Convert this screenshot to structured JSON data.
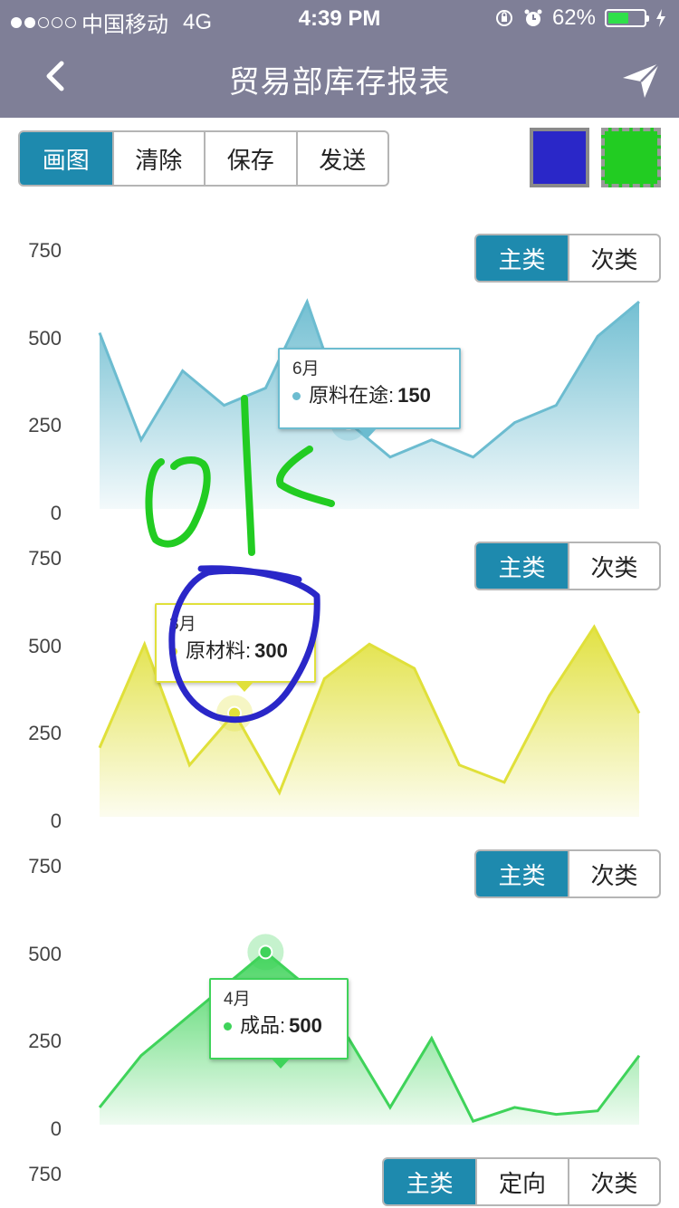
{
  "status": {
    "carrier": "中国移动",
    "network": "4G",
    "time": "4:39 PM",
    "battery": "62%",
    "battery_level": 0.62,
    "signal_bars_filled": 2,
    "signal_bars_total": 5
  },
  "nav": {
    "title": "贸易部库存报表",
    "back_icon": "chevron-left-icon",
    "send_icon": "paper-plane-icon"
  },
  "toolbar": {
    "buttons": [
      "画图",
      "清除",
      "保存",
      "发送"
    ],
    "active": "画图",
    "swatches": [
      {
        "name": "blue",
        "color": "#2a27c8"
      },
      {
        "name": "green",
        "color": "#22cc22"
      }
    ]
  },
  "charts": [
    {
      "y_ticks": [
        "750",
        "500",
        "250",
        "0"
      ],
      "tabs": [
        "主类",
        "次类"
      ],
      "active_tab": "主类",
      "color": "#6cbcd0",
      "values": [
        510,
        200,
        400,
        300,
        350,
        600,
        250,
        150,
        200,
        150,
        250,
        300,
        500,
        600
      ],
      "tooltip": {
        "month": "6月",
        "series": "原料在途",
        "value": "150"
      }
    },
    {
      "y_ticks": [
        "750",
        "500",
        "250",
        "0"
      ],
      "tabs": [
        "主类",
        "次类"
      ],
      "active_tab": "主类",
      "color": "#e0e03a",
      "values": [
        200,
        500,
        150,
        300,
        70,
        400,
        500,
        430,
        150,
        100,
        350,
        550,
        300
      ],
      "tooltip": {
        "month": "3月",
        "series": "原材料",
        "value": "300"
      }
    },
    {
      "y_ticks": [
        "750",
        "500",
        "250",
        "0"
      ],
      "tabs": [
        "主类",
        "次类"
      ],
      "active_tab": "主类",
      "color": "#3fd35a",
      "values": [
        50,
        200,
        300,
        400,
        500,
        400,
        250,
        50,
        250,
        10,
        50,
        30,
        40,
        200
      ],
      "tooltip": {
        "month": "4月",
        "series": "成品",
        "value": "500"
      }
    },
    {
      "y_ticks": [
        "750"
      ],
      "tabs": [
        "主类",
        "定向",
        "次类"
      ],
      "active_tab": "主类"
    }
  ]
}
